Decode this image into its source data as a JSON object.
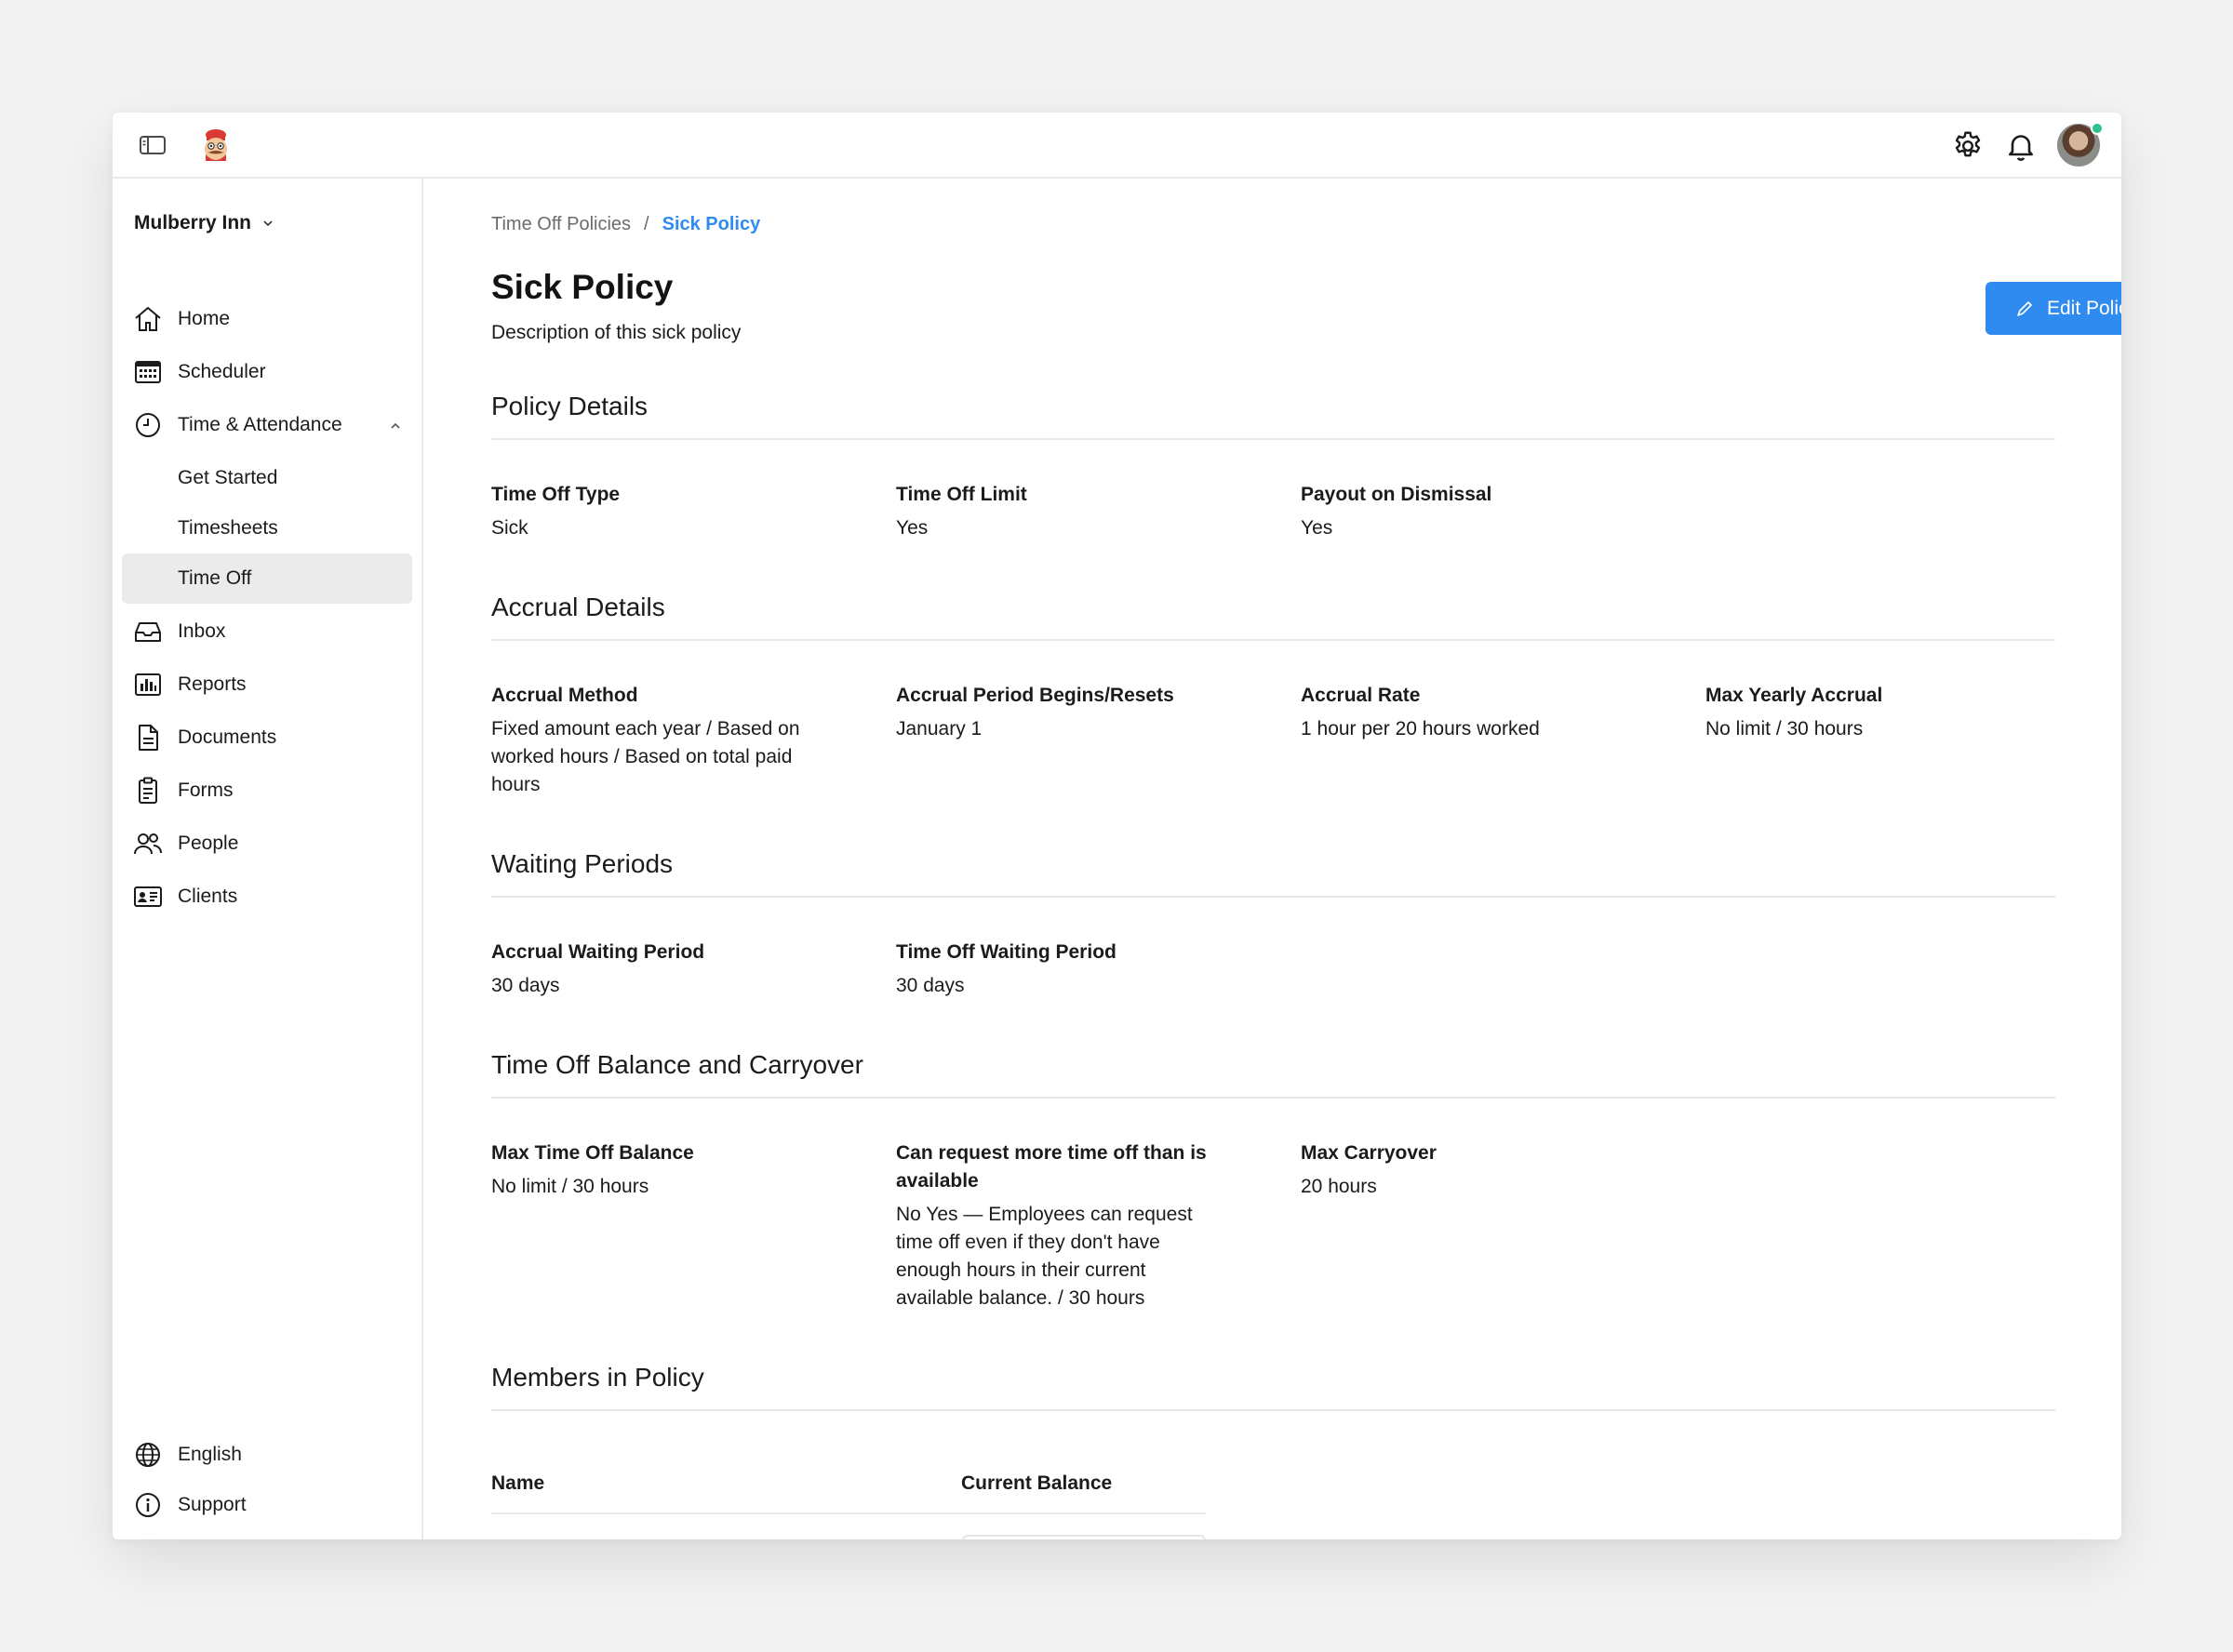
{
  "topbar": {
    "sidebar_toggle_icon": "sidebar-toggle-icon",
    "logo_icon": "chef-mascot-logo",
    "settings_icon": "gear-icon",
    "notifications_icon": "bell-icon",
    "avatar_status_color": "#2bc38b"
  },
  "sidebar": {
    "workspace": "Mulberry Inn",
    "items": [
      {
        "label": "Home",
        "icon": "home-icon"
      },
      {
        "label": "Scheduler",
        "icon": "calendar-icon"
      },
      {
        "label": "Time & Attendance",
        "icon": "clock-icon",
        "expanded": true
      },
      {
        "label": "Get Started"
      },
      {
        "label": "Timesheets"
      },
      {
        "label": "Time Off",
        "active": true
      },
      {
        "label": "Inbox",
        "icon": "inbox-icon"
      },
      {
        "label": "Reports",
        "icon": "bar-chart-icon"
      },
      {
        "label": "Documents",
        "icon": "document-icon"
      },
      {
        "label": "Forms",
        "icon": "clipboard-icon"
      },
      {
        "label": "People",
        "icon": "people-icon"
      },
      {
        "label": "Clients",
        "icon": "id-card-icon"
      }
    ],
    "bottom": [
      {
        "label": "English",
        "icon": "globe-icon"
      },
      {
        "label": "Support",
        "icon": "info-icon"
      }
    ]
  },
  "breadcrumb": {
    "parent": "Time Off Policies",
    "separator": "/",
    "current": "Sick Policy"
  },
  "page": {
    "title": "Sick Policy",
    "description": "Description of this sick policy",
    "edit_button": "Edit Policy",
    "accent_color": "#2f8bf0"
  },
  "sections": {
    "policy_details": {
      "title": "Policy Details",
      "fields": [
        {
          "label": "Time Off Type",
          "value": "Sick"
        },
        {
          "label": "Time Off Limit",
          "value": "Yes"
        },
        {
          "label": "Payout on Dismissal",
          "value": "Yes"
        }
      ]
    },
    "accrual_details": {
      "title": "Accrual Details",
      "fields": [
        {
          "label": "Accrual Method",
          "value": "Fixed amount each year / Based on worked hours / Based on total paid hours"
        },
        {
          "label": "Accrual Period Begins/Resets",
          "value": "January 1"
        },
        {
          "label": "Accrual Rate",
          "value": "1 hour per 20 hours worked"
        },
        {
          "label": "Max Yearly Accrual",
          "value": "No limit / 30 hours"
        }
      ]
    },
    "waiting_periods": {
      "title": "Waiting Periods",
      "fields": [
        {
          "label": "Accrual Waiting Period",
          "value": "30 days"
        },
        {
          "label": "Time Off Waiting Period",
          "value": "30 days"
        }
      ]
    },
    "balance_carryover": {
      "title": "Time Off Balance and Carryover",
      "fields": [
        {
          "label": "Max Time Off Balance",
          "value": "No limit / 30 hours"
        },
        {
          "label": "Can request more time off than is available",
          "value": "No Yes — Employees can request time off even if they don't have enough hours in their current available balance. / 30 hours"
        },
        {
          "label": "Max Carryover",
          "value": "20 hours"
        }
      ]
    },
    "members": {
      "title": "Members in Policy",
      "columns": [
        "Name",
        "Current Balance"
      ]
    }
  }
}
